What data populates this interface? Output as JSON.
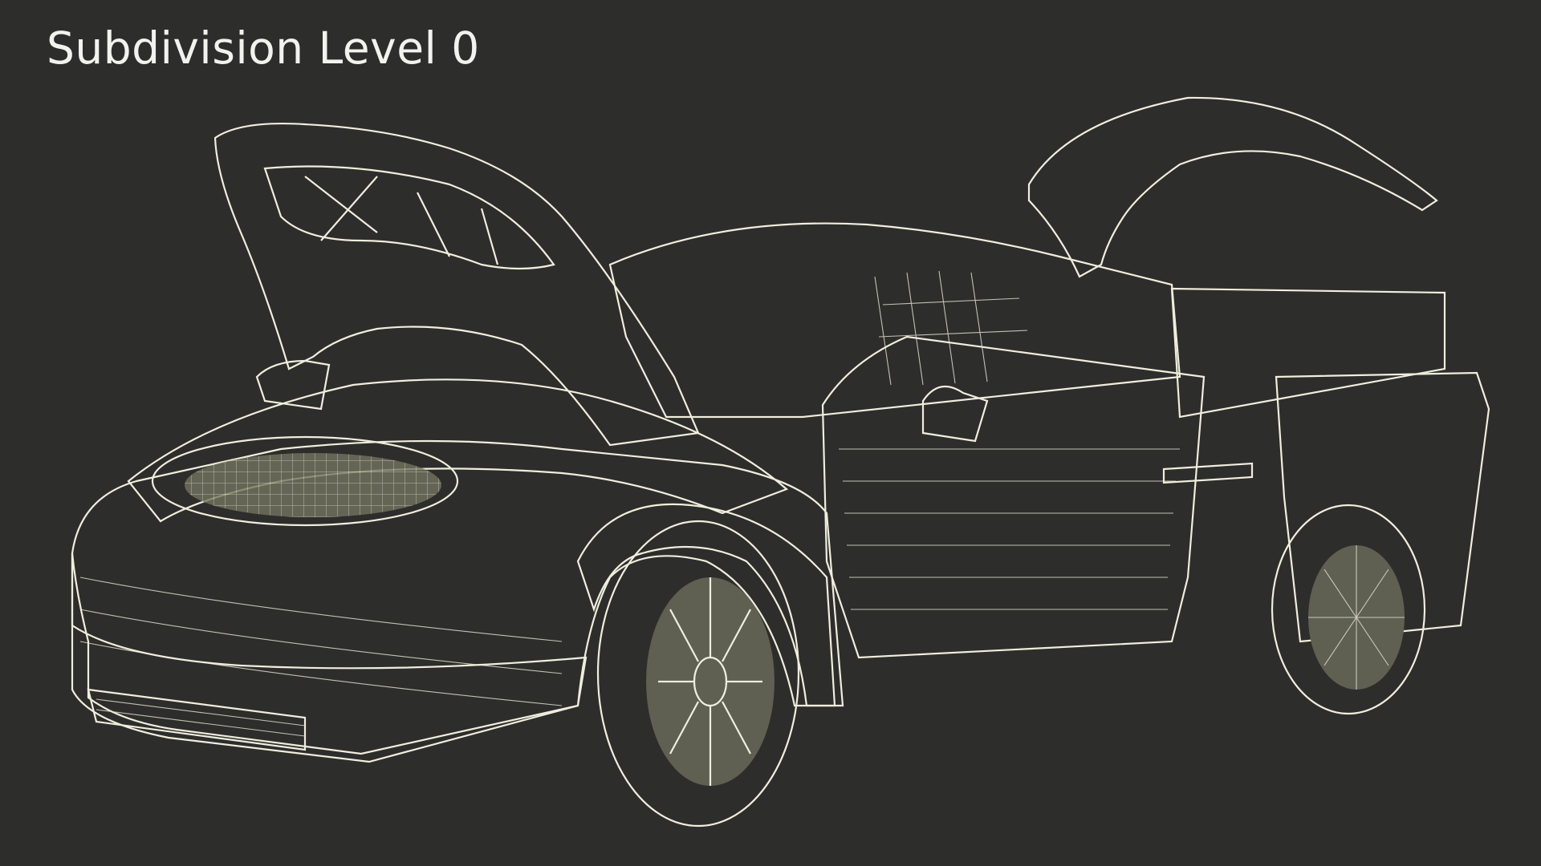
{
  "viewport": {
    "label": "Subdivision Level 0",
    "background_color": "#2d2d2b",
    "surface_color": "#777766",
    "wire_color": "#efeede"
  },
  "model": {
    "icon": "wireframe-car-render"
  }
}
